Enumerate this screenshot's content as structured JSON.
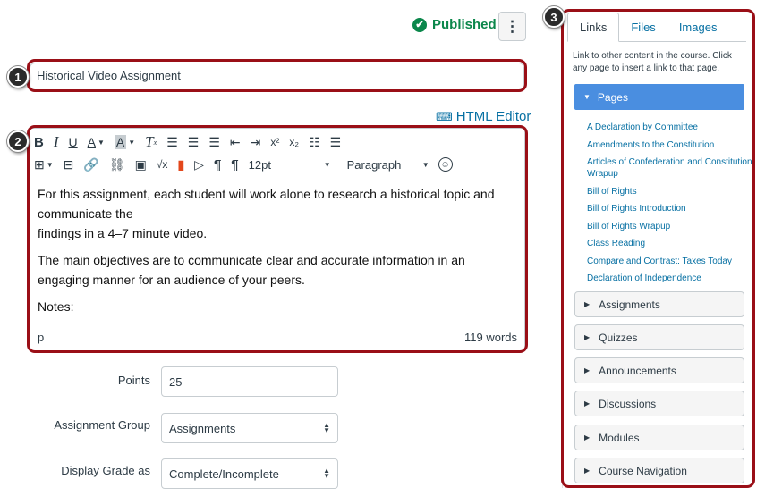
{
  "header": {
    "published_label": "Published",
    "more_label": "⋮"
  },
  "title_input": {
    "value": "Historical Video Assignment"
  },
  "callouts": [
    "1",
    "2",
    "3"
  ],
  "html_editor": {
    "label": "HTML Editor",
    "icon": "keyboard-icon"
  },
  "toolbar": {
    "bold": "B",
    "italic": "I",
    "underline": "U",
    "font_color": "A",
    "bg_color": "A",
    "clear_format": "T",
    "superscript": "x²",
    "subscript": "x₂",
    "sqrt": "√x",
    "ltr": "¶",
    "rtl": "¶",
    "font_size": "12pt",
    "block_format": "Paragraph"
  },
  "editor": {
    "paragraphs": [
      "For this assignment, each student will work alone to research a historical topic and communicate the",
      "findings in a 4–7 minute video.",
      "The main objectives are to communicate clear and accurate information in an engaging manner for an audience of your peers.",
      "Notes:"
    ],
    "path": "p",
    "word_count": "119 words"
  },
  "form": {
    "points_label": "Points",
    "points_value": "25",
    "group_label": "Assignment Group",
    "group_value": "Assignments",
    "grade_label": "Display Grade as",
    "grade_value": "Complete/Incomplete"
  },
  "sidebar": {
    "tabs": [
      "Links",
      "Files",
      "Images"
    ],
    "description": "Link to other content in the course. Click any page to insert a link to that page.",
    "open_section": "Pages",
    "pages": [
      "A Declaration by Committee",
      "Amendments to the Constitution",
      "Articles of Confederation and Constitution Wrapup",
      "Bill of Rights",
      "Bill of Rights Introduction",
      "Bill of Rights Wrapup",
      "Class Reading",
      "Compare and Contrast: Taxes Today",
      "Declaration of Independence"
    ],
    "sections": [
      "Assignments",
      "Quizzes",
      "Announcements",
      "Discussions",
      "Modules",
      "Course Navigation"
    ]
  }
}
